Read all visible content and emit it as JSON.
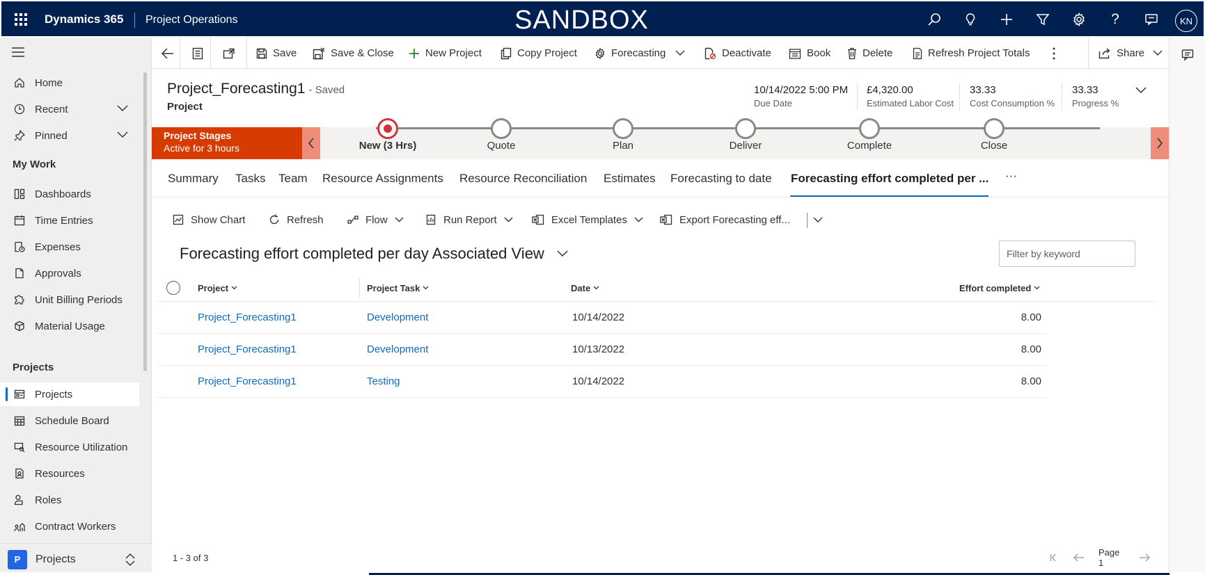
{
  "header": {
    "brand": "Dynamics 365",
    "module": "Project Operations",
    "environment": "SANDBOX",
    "user_initials": "KN"
  },
  "sidebar": {
    "items": [
      {
        "label": "Home",
        "icon": "home-icon"
      },
      {
        "label": "Recent",
        "icon": "clock-icon"
      },
      {
        "label": "Pinned",
        "icon": "pin-icon"
      }
    ],
    "sections": [
      {
        "title": "My Work",
        "items": [
          "Dashboards",
          "Time Entries",
          "Expenses",
          "Approvals",
          "Unit Billing Periods",
          "Material Usage"
        ]
      },
      {
        "title": "Projects",
        "items": [
          "Projects",
          "Schedule Board",
          "Resource Utilization",
          "Resources",
          "Roles",
          "Contract Workers"
        ]
      }
    ],
    "area": {
      "badge": "P",
      "label": "Projects"
    }
  },
  "commandbar": {
    "save": "Save",
    "save_close": "Save & Close",
    "new_project": "New Project",
    "copy_project": "Copy Project",
    "forecasting": "Forecasting",
    "deactivate": "Deactivate",
    "book": "Book",
    "delete": "Delete",
    "refresh_totals": "Refresh Project Totals",
    "share": "Share"
  },
  "record": {
    "title": "Project_Forecasting1",
    "status": "- Saved",
    "entity": "Project",
    "kpis": [
      {
        "value": "10/14/2022 5:00 PM",
        "label": "Due Date"
      },
      {
        "value": "£4,320.00",
        "label": "Estimated Labor Cost"
      },
      {
        "value": "33.33",
        "label": "Cost Consumption %"
      },
      {
        "value": "33.33",
        "label": "Progress %"
      }
    ]
  },
  "bpf": {
    "title": "Project Stages",
    "subtitle": "Active for 3 hours",
    "stages": [
      "New  (3 Hrs)",
      "Quote",
      "Plan",
      "Deliver",
      "Complete",
      "Close"
    ],
    "active_stage": 0,
    "accent": "#d83b01"
  },
  "tabs": [
    "Summary",
    "Tasks",
    "Team",
    "Resource Assignments",
    "Resource Reconciliation",
    "Estimates",
    "Forecasting to date",
    "Forecasting effort completed per ...",
    "···"
  ],
  "active_tab": 7,
  "subgrid": {
    "commands": {
      "show_chart": "Show Chart",
      "refresh": "Refresh",
      "flow": "Flow",
      "run_report": "Run Report",
      "excel_templates": "Excel Templates",
      "export": "Export Forecasting eff..."
    },
    "view_title": "Forecasting effort completed per day Associated View",
    "filter_placeholder": "Filter by keyword",
    "columns": [
      "Project",
      "Project Task",
      "Date",
      "Effort completed"
    ],
    "rows": [
      {
        "project": "Project_Forecasting1",
        "task": "Development",
        "date": "10/14/2022",
        "effort": "8.00"
      },
      {
        "project": "Project_Forecasting1",
        "task": "Development",
        "date": "10/13/2022",
        "effort": "8.00"
      },
      {
        "project": "Project_Forecasting1",
        "task": "Testing",
        "date": "10/14/2022",
        "effort": "8.00"
      }
    ],
    "record_count": "1 - 3 of 3",
    "page_label": "Page 1"
  },
  "colors": {
    "header_bg": "#002050",
    "link": "#0f6cbd",
    "accent_red": "#d13438"
  }
}
